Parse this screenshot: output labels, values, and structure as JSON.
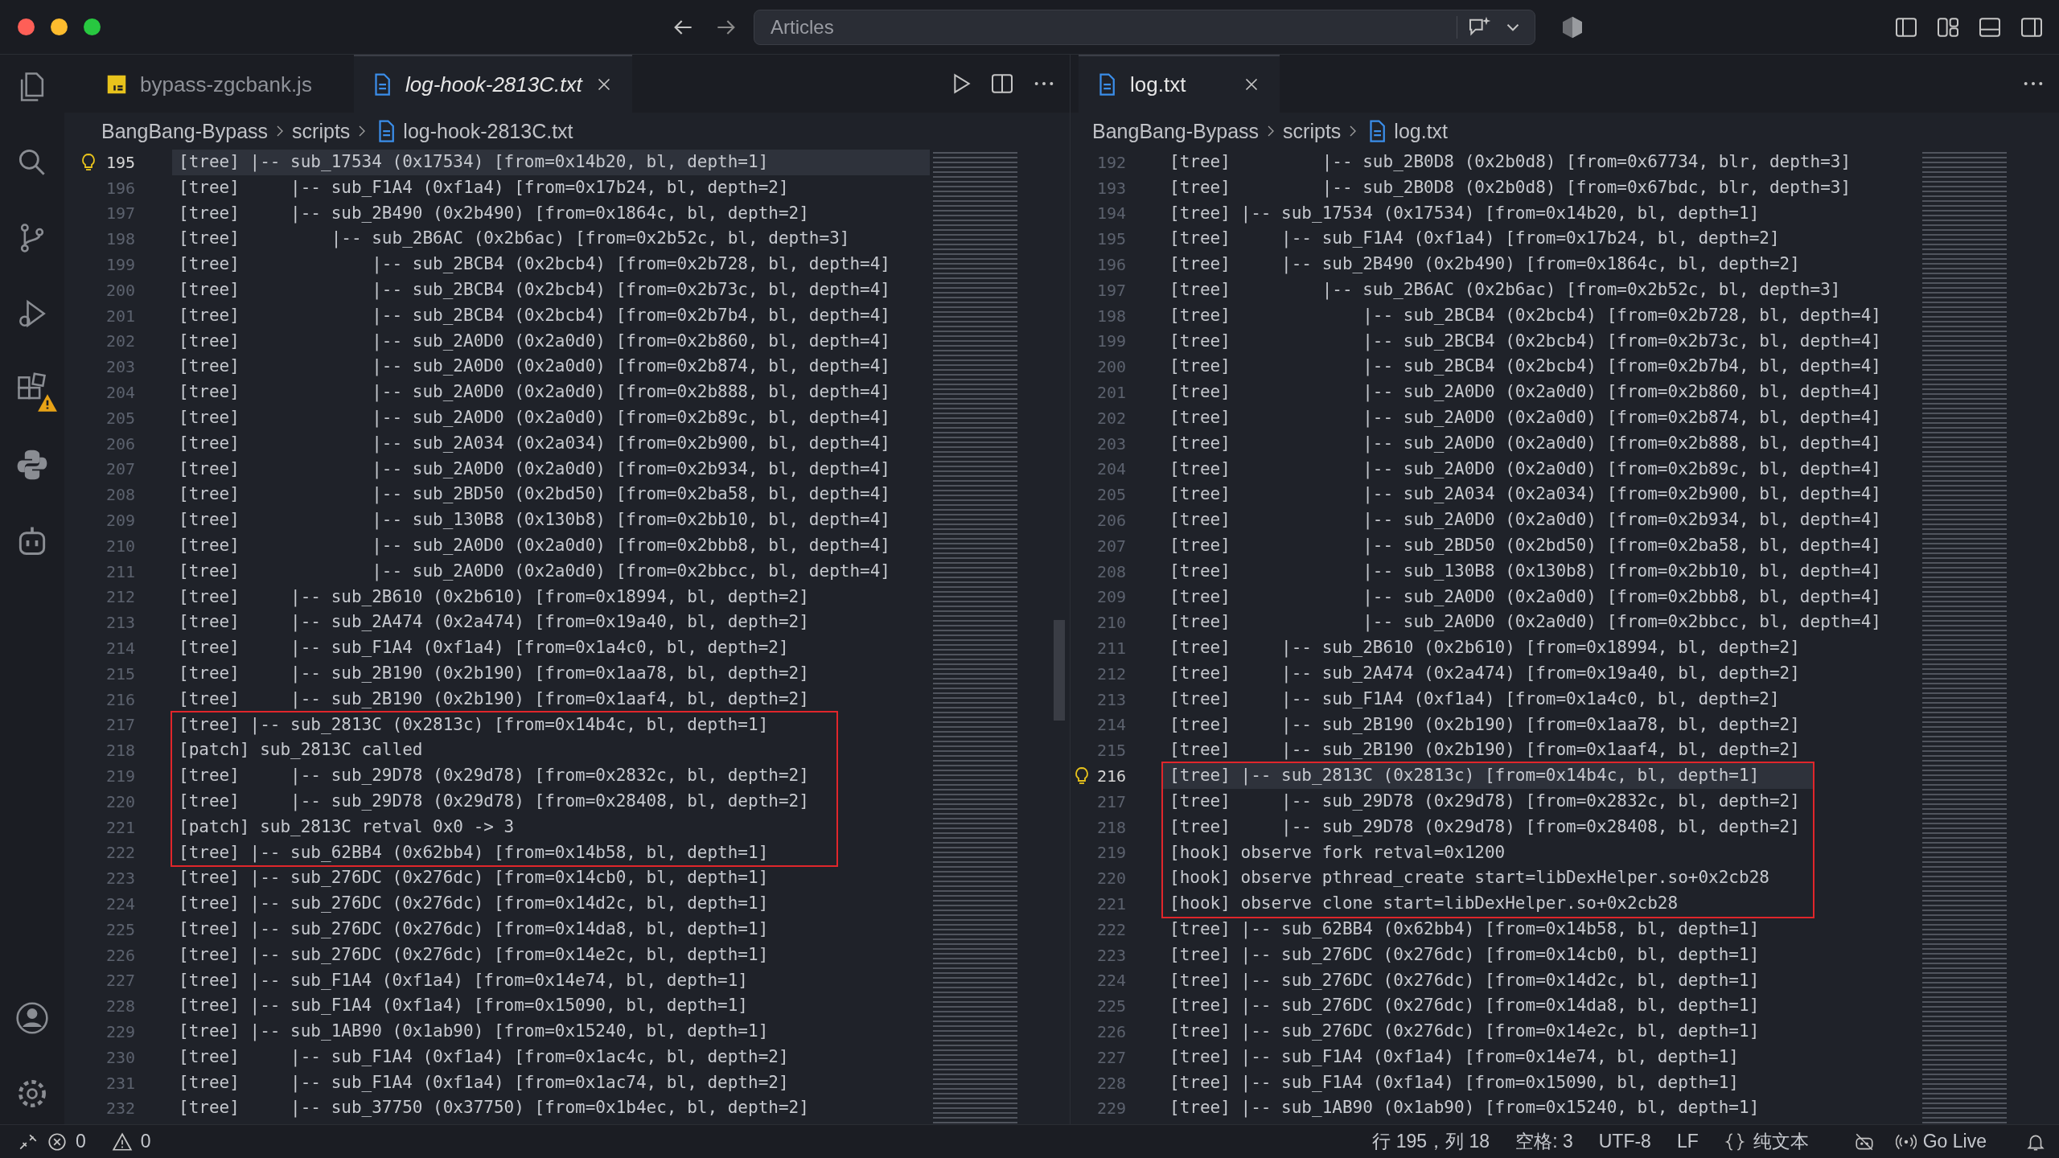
{
  "title_bar": {
    "search": {
      "value": "Articles"
    }
  },
  "editors": [
    {
      "tabs": [
        {
          "label": "bypass-zgcbank.js",
          "kind": "js",
          "selected": false,
          "preview": false
        },
        {
          "label": "log-hook-2813C.txt",
          "kind": "text",
          "selected": true,
          "preview": true
        }
      ],
      "breadcrumb": [
        "BangBang-Bypass",
        "scripts",
        "log-hook-2813C.txt"
      ],
      "blocks": [
        {
          "highlighted": false,
          "lines": [
            {
              "number": "195",
              "text": "[tree] |-- sub_17534 (0x17534) [from=0x14b20, bl, depth=1]",
              "current": true
            },
            {
              "number": "196",
              "text": "[tree]     |-- sub_F1A4 (0xf1a4) [from=0x17b24, bl, depth=2]",
              "current": false
            },
            {
              "number": "197",
              "text": "[tree]     |-- sub_2B490 (0x2b490) [from=0x1864c, bl, depth=2]",
              "current": false
            },
            {
              "number": "198",
              "text": "[tree]         |-- sub_2B6AC (0x2b6ac) [from=0x2b52c, bl, depth=3]",
              "current": false
            },
            {
              "number": "199",
              "text": "[tree]             |-- sub_2BCB4 (0x2bcb4) [from=0x2b728, bl, depth=4]",
              "current": false
            },
            {
              "number": "200",
              "text": "[tree]             |-- sub_2BCB4 (0x2bcb4) [from=0x2b73c, bl, depth=4]",
              "current": false
            },
            {
              "number": "201",
              "text": "[tree]             |-- sub_2BCB4 (0x2bcb4) [from=0x2b7b4, bl, depth=4]",
              "current": false
            },
            {
              "number": "202",
              "text": "[tree]             |-- sub_2A0D0 (0x2a0d0) [from=0x2b860, bl, depth=4]",
              "current": false
            },
            {
              "number": "203",
              "text": "[tree]             |-- sub_2A0D0 (0x2a0d0) [from=0x2b874, bl, depth=4]",
              "current": false
            },
            {
              "number": "204",
              "text": "[tree]             |-- sub_2A0D0 (0x2a0d0) [from=0x2b888, bl, depth=4]",
              "current": false
            },
            {
              "number": "205",
              "text": "[tree]             |-- sub_2A0D0 (0x2a0d0) [from=0x2b89c, bl, depth=4]",
              "current": false
            },
            {
              "number": "206",
              "text": "[tree]             |-- sub_2A034 (0x2a034) [from=0x2b900, bl, depth=4]",
              "current": false
            },
            {
              "number": "207",
              "text": "[tree]             |-- sub_2A0D0 (0x2a0d0) [from=0x2b934, bl, depth=4]",
              "current": false
            },
            {
              "number": "208",
              "text": "[tree]             |-- sub_2BD50 (0x2bd50) [from=0x2ba58, bl, depth=4]",
              "current": false
            },
            {
              "number": "209",
              "text": "[tree]             |-- sub_130B8 (0x130b8) [from=0x2bb10, bl, depth=4]",
              "current": false
            },
            {
              "number": "210",
              "text": "[tree]             |-- sub_2A0D0 (0x2a0d0) [from=0x2bbb8, bl, depth=4]",
              "current": false
            },
            {
              "number": "211",
              "text": "[tree]             |-- sub_2A0D0 (0x2a0d0) [from=0x2bbcc, bl, depth=4]",
              "current": false
            },
            {
              "number": "212",
              "text": "[tree]     |-- sub_2B610 (0x2b610) [from=0x18994, bl, depth=2]",
              "current": false
            },
            {
              "number": "213",
              "text": "[tree]     |-- sub_2A474 (0x2a474) [from=0x19a40, bl, depth=2]",
              "current": false
            },
            {
              "number": "214",
              "text": "[tree]     |-- sub_F1A4 (0xf1a4) [from=0x1a4c0, bl, depth=2]",
              "current": false
            },
            {
              "number": "215",
              "text": "[tree]     |-- sub_2B190 (0x2b190) [from=0x1aa78, bl, depth=2]",
              "current": false
            },
            {
              "number": "216",
              "text": "[tree]     |-- sub_2B190 (0x2b190) [from=0x1aaf4, bl, depth=2]",
              "current": false
            }
          ]
        },
        {
          "highlighted": true,
          "lines": [
            {
              "number": "217",
              "text": "[tree] |-- sub_2813C (0x2813c) [from=0x14b4c, bl, depth=1]",
              "current": false
            },
            {
              "number": "218",
              "text": "[patch] sub_2813C called",
              "current": false
            },
            {
              "number": "219",
              "text": "[tree]     |-- sub_29D78 (0x29d78) [from=0x2832c, bl, depth=2]",
              "current": false
            },
            {
              "number": "220",
              "text": "[tree]     |-- sub_29D78 (0x29d78) [from=0x28408, bl, depth=2]",
              "current": false
            },
            {
              "number": "221",
              "text": "[patch] sub_2813C retval 0x0 -> 3",
              "current": false
            },
            {
              "number": "222",
              "text": "[tree] |-- sub_62BB4 (0x62bb4) [from=0x14b58, bl, depth=1]",
              "current": false
            }
          ]
        },
        {
          "highlighted": false,
          "lines": [
            {
              "number": "223",
              "text": "[tree] |-- sub_276DC (0x276dc) [from=0x14cb0, bl, depth=1]",
              "current": false
            },
            {
              "number": "224",
              "text": "[tree] |-- sub_276DC (0x276dc) [from=0x14d2c, bl, depth=1]",
              "current": false
            },
            {
              "number": "225",
              "text": "[tree] |-- sub_276DC (0x276dc) [from=0x14da8, bl, depth=1]",
              "current": false
            },
            {
              "number": "226",
              "text": "[tree] |-- sub_276DC (0x276dc) [from=0x14e2c, bl, depth=1]",
              "current": false
            },
            {
              "number": "227",
              "text": "[tree] |-- sub_F1A4 (0xf1a4) [from=0x14e74, bl, depth=1]",
              "current": false
            },
            {
              "number": "228",
              "text": "[tree] |-- sub_F1A4 (0xf1a4) [from=0x15090, bl, depth=1]",
              "current": false
            },
            {
              "number": "229",
              "text": "[tree] |-- sub_1AB90 (0x1ab90) [from=0x15240, bl, depth=1]",
              "current": false
            },
            {
              "number": "230",
              "text": "[tree]     |-- sub_F1A4 (0xf1a4) [from=0x1ac4c, bl, depth=2]",
              "current": false
            },
            {
              "number": "231",
              "text": "[tree]     |-- sub_F1A4 (0xf1a4) [from=0x1ac74, bl, depth=2]",
              "current": false
            },
            {
              "number": "232",
              "text": "[tree]     |-- sub_37750 (0x37750) [from=0x1b4ec, bl, depth=2]",
              "current": false
            }
          ]
        }
      ]
    },
    {
      "tabs": [
        {
          "label": "log.txt",
          "kind": "text",
          "selected": true,
          "preview": false
        }
      ],
      "breadcrumb": [
        "BangBang-Bypass",
        "scripts",
        "log.txt"
      ],
      "blocks": [
        {
          "highlighted": false,
          "lines": [
            {
              "number": "192",
              "text": "[tree]         |-- sub_2B0D8 (0x2b0d8) [from=0x67734, blr, depth=3]",
              "current": false
            },
            {
              "number": "193",
              "text": "[tree]         |-- sub_2B0D8 (0x2b0d8) [from=0x67bdc, blr, depth=3]",
              "current": false
            },
            {
              "number": "194",
              "text": "[tree] |-- sub_17534 (0x17534) [from=0x14b20, bl, depth=1]",
              "current": false
            },
            {
              "number": "195",
              "text": "[tree]     |-- sub_F1A4 (0xf1a4) [from=0x17b24, bl, depth=2]",
              "current": false
            },
            {
              "number": "196",
              "text": "[tree]     |-- sub_2B490 (0x2b490) [from=0x1864c, bl, depth=2]",
              "current": false
            },
            {
              "number": "197",
              "text": "[tree]         |-- sub_2B6AC (0x2b6ac) [from=0x2b52c, bl, depth=3]",
              "current": false
            },
            {
              "number": "198",
              "text": "[tree]             |-- sub_2BCB4 (0x2bcb4) [from=0x2b728, bl, depth=4]",
              "current": false
            },
            {
              "number": "199",
              "text": "[tree]             |-- sub_2BCB4 (0x2bcb4) [from=0x2b73c, bl, depth=4]",
              "current": false
            },
            {
              "number": "200",
              "text": "[tree]             |-- sub_2BCB4 (0x2bcb4) [from=0x2b7b4, bl, depth=4]",
              "current": false
            },
            {
              "number": "201",
              "text": "[tree]             |-- sub_2A0D0 (0x2a0d0) [from=0x2b860, bl, depth=4]",
              "current": false
            },
            {
              "number": "202",
              "text": "[tree]             |-- sub_2A0D0 (0x2a0d0) [from=0x2b874, bl, depth=4]",
              "current": false
            },
            {
              "number": "203",
              "text": "[tree]             |-- sub_2A0D0 (0x2a0d0) [from=0x2b888, bl, depth=4]",
              "current": false
            },
            {
              "number": "204",
              "text": "[tree]             |-- sub_2A0D0 (0x2a0d0) [from=0x2b89c, bl, depth=4]",
              "current": false
            },
            {
              "number": "205",
              "text": "[tree]             |-- sub_2A034 (0x2a034) [from=0x2b900, bl, depth=4]",
              "current": false
            },
            {
              "number": "206",
              "text": "[tree]             |-- sub_2A0D0 (0x2a0d0) [from=0x2b934, bl, depth=4]",
              "current": false
            },
            {
              "number": "207",
              "text": "[tree]             |-- sub_2BD50 (0x2bd50) [from=0x2ba58, bl, depth=4]",
              "current": false
            },
            {
              "number": "208",
              "text": "[tree]             |-- sub_130B8 (0x130b8) [from=0x2bb10, bl, depth=4]",
              "current": false
            },
            {
              "number": "209",
              "text": "[tree]             |-- sub_2A0D0 (0x2a0d0) [from=0x2bbb8, bl, depth=4]",
              "current": false
            },
            {
              "number": "210",
              "text": "[tree]             |-- sub_2A0D0 (0x2a0d0) [from=0x2bbcc, bl, depth=4]",
              "current": false
            },
            {
              "number": "211",
              "text": "[tree]     |-- sub_2B610 (0x2b610) [from=0x18994, bl, depth=2]",
              "current": false
            },
            {
              "number": "212",
              "text": "[tree]     |-- sub_2A474 (0x2a474) [from=0x19a40, bl, depth=2]",
              "current": false
            },
            {
              "number": "213",
              "text": "[tree]     |-- sub_F1A4 (0xf1a4) [from=0x1a4c0, bl, depth=2]",
              "current": false
            },
            {
              "number": "214",
              "text": "[tree]     |-- sub_2B190 (0x2b190) [from=0x1aa78, bl, depth=2]",
              "current": false
            },
            {
              "number": "215",
              "text": "[tree]     |-- sub_2B190 (0x2b190) [from=0x1aaf4, bl, depth=2]",
              "current": false
            }
          ]
        },
        {
          "highlighted": true,
          "lines": [
            {
              "number": "216",
              "text": "[tree] |-- sub_2813C (0x2813c) [from=0x14b4c, bl, depth=1]",
              "current": true
            },
            {
              "number": "217",
              "text": "[tree]     |-- sub_29D78 (0x29d78) [from=0x2832c, bl, depth=2]",
              "current": false
            },
            {
              "number": "218",
              "text": "[tree]     |-- sub_29D78 (0x29d78) [from=0x28408, bl, depth=2]",
              "current": false
            },
            {
              "number": "219",
              "text": "[hook] observe fork retval=0x1200",
              "current": false
            },
            {
              "number": "220",
              "text": "[hook] observe pthread_create start=libDexHelper.so+0x2cb28",
              "current": false
            },
            {
              "number": "221",
              "text": "[hook] observe clone start=libDexHelper.so+0x2cb28",
              "current": false
            }
          ]
        },
        {
          "highlighted": false,
          "lines": [
            {
              "number": "222",
              "text": "[tree] |-- sub_62BB4 (0x62bb4) [from=0x14b58, bl, depth=1]",
              "current": false
            },
            {
              "number": "223",
              "text": "[tree] |-- sub_276DC (0x276dc) [from=0x14cb0, bl, depth=1]",
              "current": false
            },
            {
              "number": "224",
              "text": "[tree] |-- sub_276DC (0x276dc) [from=0x14d2c, bl, depth=1]",
              "current": false
            },
            {
              "number": "225",
              "text": "[tree] |-- sub_276DC (0x276dc) [from=0x14da8, bl, depth=1]",
              "current": false
            },
            {
              "number": "226",
              "text": "[tree] |-- sub_276DC (0x276dc) [from=0x14e2c, bl, depth=1]",
              "current": false
            },
            {
              "number": "227",
              "text": "[tree] |-- sub_F1A4 (0xf1a4) [from=0x14e74, bl, depth=1]",
              "current": false
            },
            {
              "number": "228",
              "text": "[tree] |-- sub_F1A4 (0xf1a4) [from=0x15090, bl, depth=1]",
              "current": false
            },
            {
              "number": "229",
              "text": "[tree] |-- sub_1AB90 (0x1ab90) [from=0x15240, bl, depth=1]",
              "current": false
            }
          ]
        }
      ]
    }
  ],
  "status_bar": {
    "errors": "0",
    "warnings": "0",
    "position": "行 195，列 18",
    "indentation": "空格: 3",
    "encoding": "UTF-8",
    "eol": "LF",
    "language": "纯文本",
    "go_live": "Go Live"
  }
}
